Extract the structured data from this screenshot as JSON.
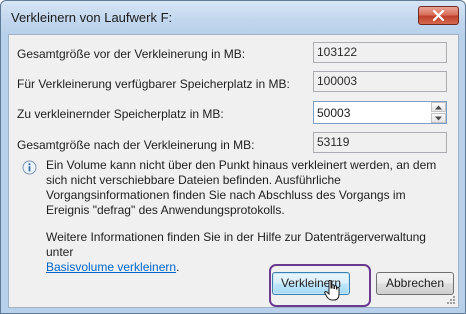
{
  "window": {
    "title": "Verkleinern von Laufwerk F:",
    "close_symbol": "✕"
  },
  "fields": [
    {
      "label": "Gesamtgröße vor der Verkleinerung in MB:",
      "value": "103122"
    },
    {
      "label": "Für Verkleinerung verfügbarer Speicherplatz in MB:",
      "value": "100003"
    },
    {
      "label": "Zu verkleinernder Speicherplatz in MB:",
      "value": "50003"
    },
    {
      "label": "Gesamtgröße nach der Verkleinerung in MB:",
      "value": "53119"
    }
  ],
  "info": {
    "icon": "info-icon",
    "text": "Ein Volume kann nicht über den Punkt hinaus verkleinert werden, an dem sich nicht verschiebbare Dateien befinden. Ausführliche Vorgangsinformationen finden Sie nach Abschluss des Vorgangs im Ereignis \"defrag\" des Anwendungsprotokolls."
  },
  "more": {
    "text": "Weitere Informationen finden Sie in der Hilfe zur Datenträgerverwaltung unter",
    "link": "Basisvolume verkleinern",
    "suffix": "."
  },
  "buttons": {
    "shrink": "Verkleinern",
    "cancel": "Abbrechen"
  },
  "colors": {
    "link": "#0066cc",
    "highlight_outline": "#6a3a8e",
    "close_button": "#c0402a"
  }
}
